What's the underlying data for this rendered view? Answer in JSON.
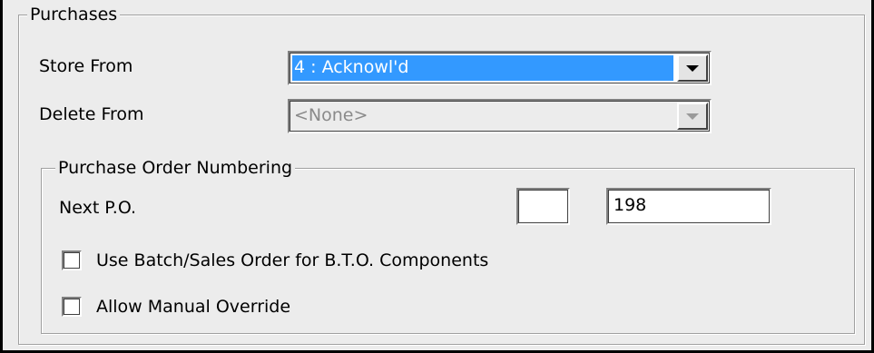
{
  "purchases": {
    "group_title": "Purchases",
    "store_from": {
      "label": "Store From",
      "value": "4 : Acknowl'd"
    },
    "delete_from": {
      "label": "Delete From",
      "value": "<None>"
    },
    "po_numbering": {
      "group_title": "Purchase Order Numbering",
      "next_po_label": "Next P.O.",
      "prefix_value": "",
      "number_value": "198",
      "use_batch_label": "Use Batch/Sales Order for B.T.O. Components",
      "use_batch_checked": false,
      "allow_override_label": "Allow Manual Override",
      "allow_override_checked": false
    }
  },
  "colors": {
    "selection": "#3399ff",
    "face": "#ececec"
  }
}
